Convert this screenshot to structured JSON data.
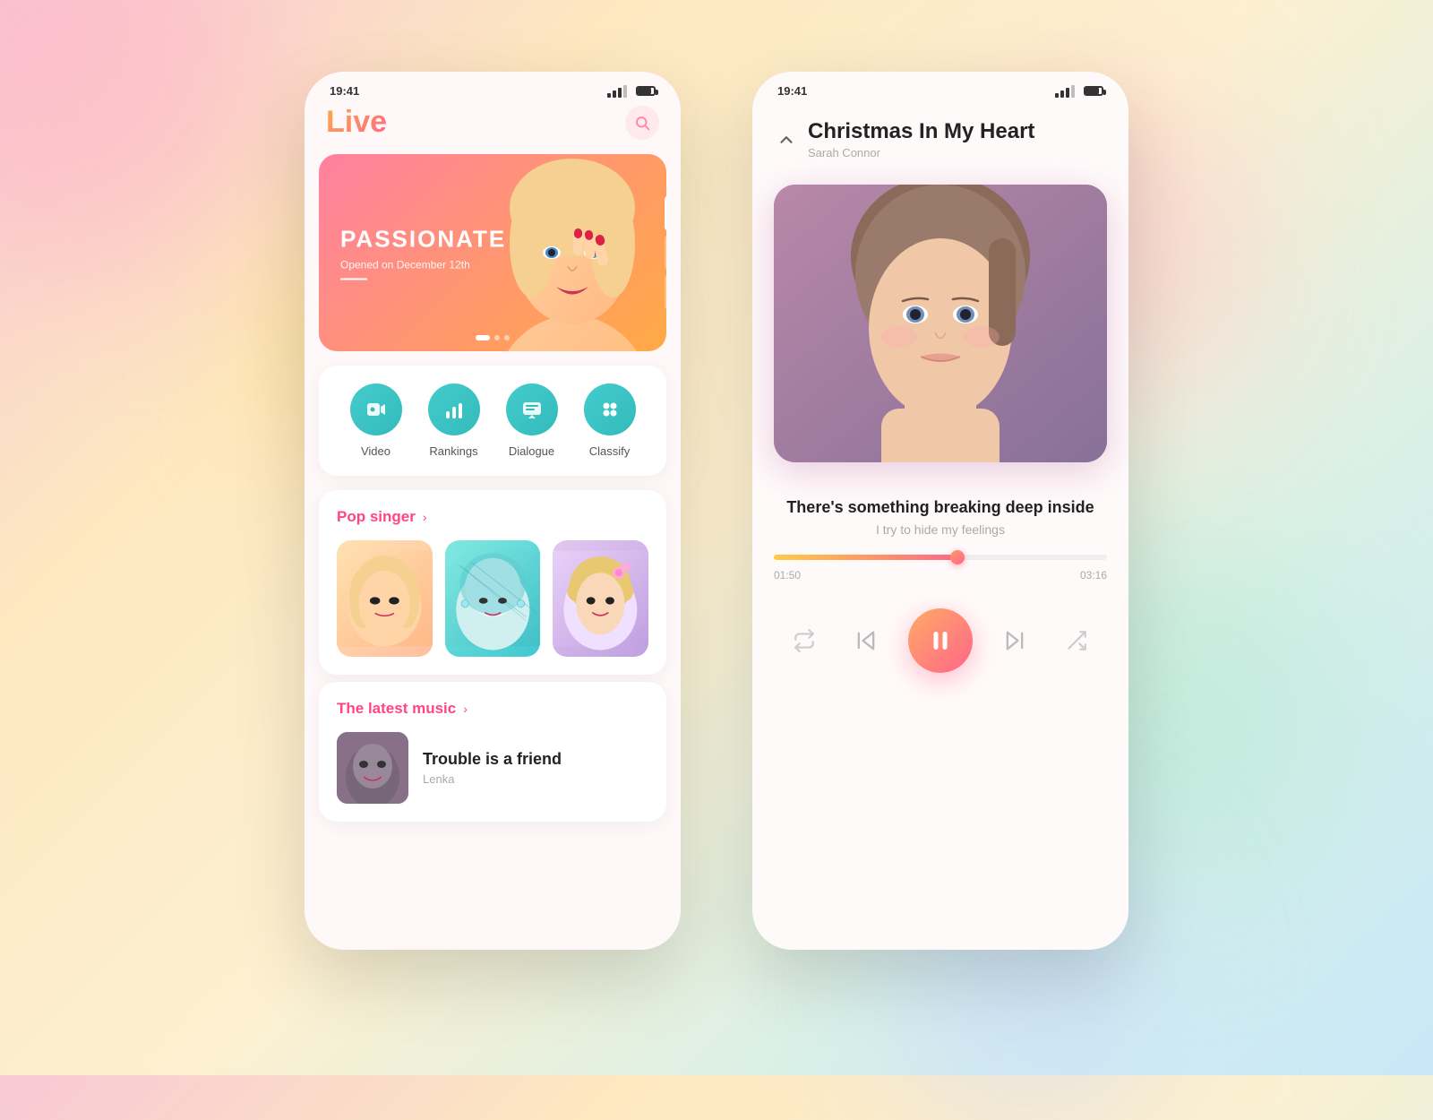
{
  "background": {
    "gradient": "linear-gradient(135deg, #f8c8d4 0%, #fde8c0 25%, #fdf0d0 50%, #d8f0e8 75%, #c8e8f8 100%)"
  },
  "left_phone": {
    "status_bar": {
      "time": "19:41"
    },
    "header": {
      "title": "Live",
      "search_label": "search"
    },
    "hero": {
      "title": "PASSIONATE",
      "subtitle": "Opened on December 12th"
    },
    "categories": [
      {
        "id": "video",
        "label": "Video",
        "icon": "🎥"
      },
      {
        "id": "rankings",
        "label": "Rankings",
        "icon": "📊"
      },
      {
        "id": "dialogue",
        "label": "Dialogue",
        "icon": "📺"
      },
      {
        "id": "classify",
        "label": "Classify",
        "icon": "⋯"
      }
    ],
    "pop_singer": {
      "section_title": "Pop singer",
      "arrow": "›"
    },
    "latest_music": {
      "section_title": "The latest music",
      "arrow": "›",
      "items": [
        {
          "title": "Trouble is a friend",
          "artist": "Lenka"
        }
      ]
    }
  },
  "right_phone": {
    "status_bar": {
      "time": "19:41"
    },
    "player": {
      "song_title": "Christmas In My Heart",
      "artist": "Sarah Connor",
      "lyric_main": "There's something breaking deep inside",
      "lyric_sub": "I try to hide my feelings",
      "time_current": "01:50",
      "time_total": "03:16",
      "progress_percent": 55
    },
    "controls": {
      "repeat_label": "repeat",
      "prev_label": "previous",
      "play_pause_label": "pause",
      "next_label": "next",
      "shuffle_label": "shuffle"
    }
  }
}
